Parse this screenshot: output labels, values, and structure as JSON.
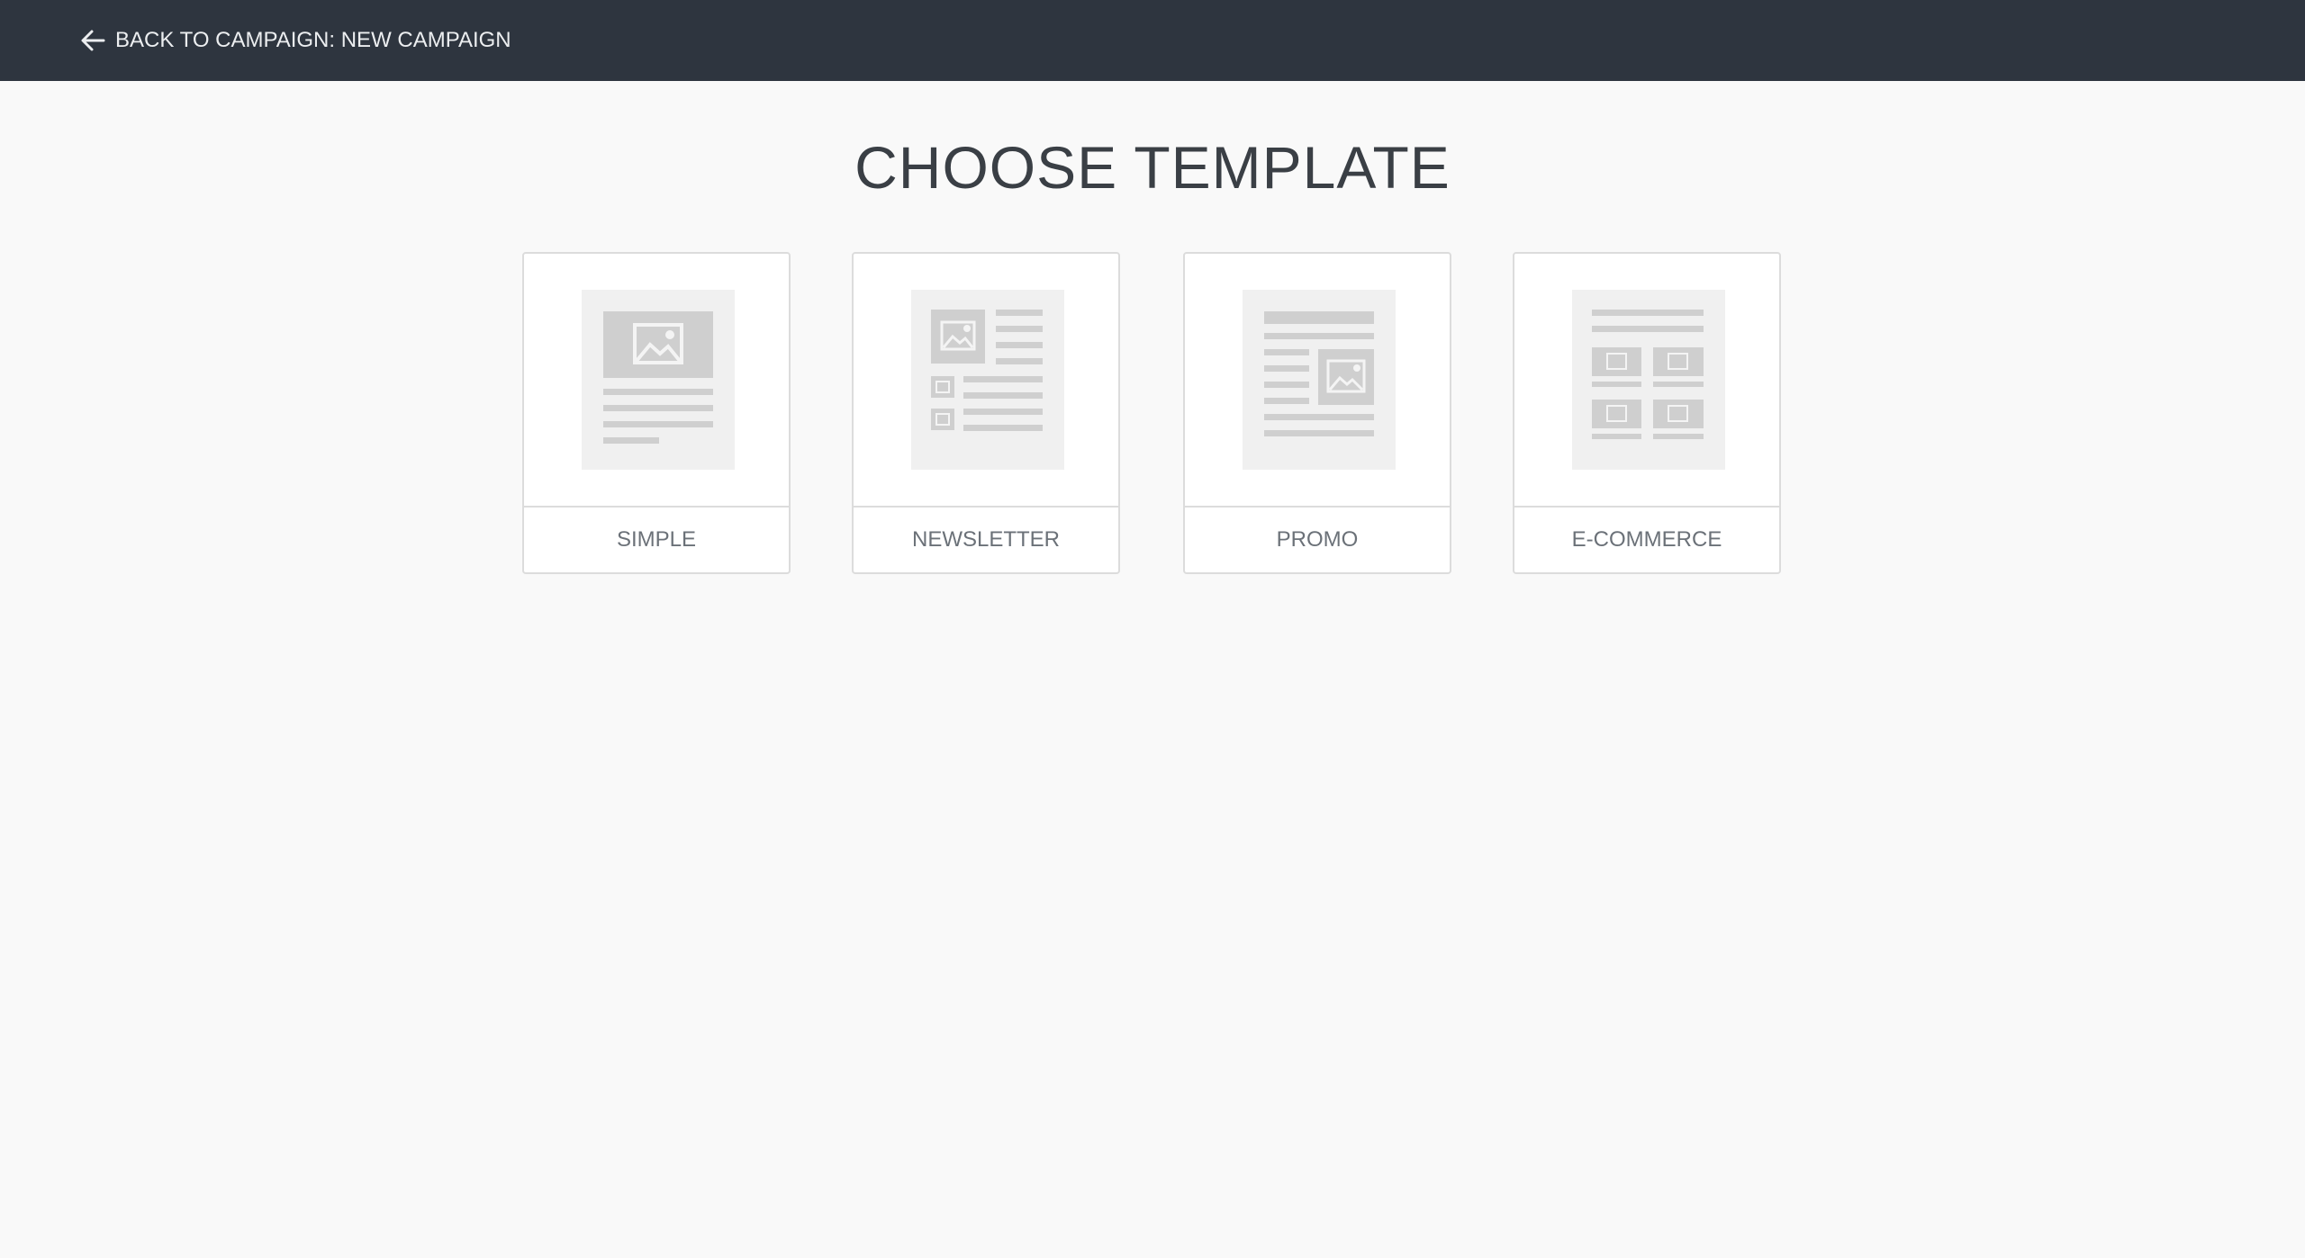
{
  "header": {
    "back_label": "BACK TO CAMPAIGN: NEW CAMPAIGN",
    "back_icon": "arrow-left-icon",
    "background_color": "#2e353f"
  },
  "main": {
    "title": "CHOOSE TEMPLATE",
    "templates": [
      {
        "label": "SIMPLE",
        "icon": "simple-template-icon"
      },
      {
        "label": "NEWSLETTER",
        "icon": "newsletter-template-icon"
      },
      {
        "label": "PROMO",
        "icon": "promo-template-icon"
      },
      {
        "label": "E-COMMERCE",
        "icon": "ecommerce-template-icon"
      }
    ]
  },
  "colors": {
    "page_background": "#f9f9f9",
    "card_border": "#dcdcdc",
    "placeholder_gray": "#cfcfcf"
  }
}
